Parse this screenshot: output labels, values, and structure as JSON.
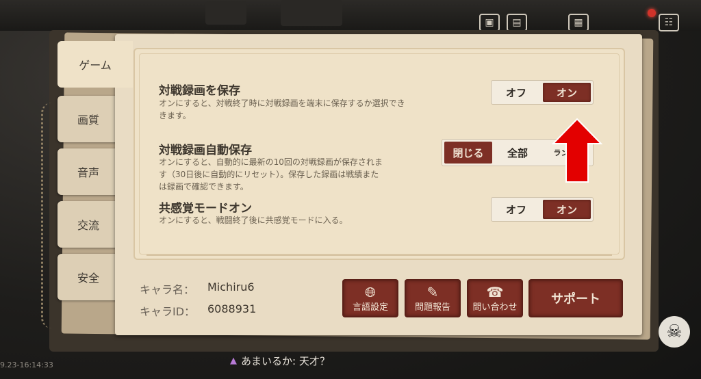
{
  "tabs": [
    {
      "label": "ゲーム",
      "active": true
    },
    {
      "label": "画質",
      "active": false
    },
    {
      "label": "音声",
      "active": false
    },
    {
      "label": "交流",
      "active": false
    },
    {
      "label": "安全",
      "active": false
    }
  ],
  "settings": [
    {
      "title": "対戦録画を保存",
      "description_lines": [
        "オンにすると、対戦終了時に対戦録画を端末に保存するか選択でき",
        "きます。"
      ],
      "options": [
        "オフ",
        "オン"
      ],
      "selected": "オン"
    },
    {
      "title": "対戦録画自動保存",
      "description_lines": [
        "オンにすると、自動的に最新の10回の対戦録画が保存されま",
        "す（30日後に自動的にリセット）。保存した録画は戦績また",
        "は録画で確認できます。"
      ],
      "options": [
        "閉じる",
        "全部",
        "ランク"
      ],
      "selected": "閉じる"
    },
    {
      "title": "共感覚モードオン",
      "description_lines": [
        "オンにすると、戦闘終了後に共感覚モードに入る。"
      ],
      "options": [
        "オフ",
        "オン"
      ],
      "selected": "オン"
    }
  ],
  "character": {
    "name_label": "キャラ名：",
    "name_value": "Michiru6",
    "id_label": "キャラID：",
    "id_value": "6088931"
  },
  "buttons": [
    {
      "label": "言語設定",
      "icon": "globe-icon"
    },
    {
      "label": "問題報告",
      "icon": "pen-icon"
    },
    {
      "label": "問い合わせ",
      "icon": "telephone-icon"
    }
  ],
  "support_button": "サポート",
  "footer": {
    "timestamp": "9.23-16:14:33",
    "chat_message": "あまいるか: 天才？"
  },
  "colors": {
    "accent": "#7d2f25",
    "panel": "#e9dcc4",
    "annotation_arrow": "#e30000"
  }
}
